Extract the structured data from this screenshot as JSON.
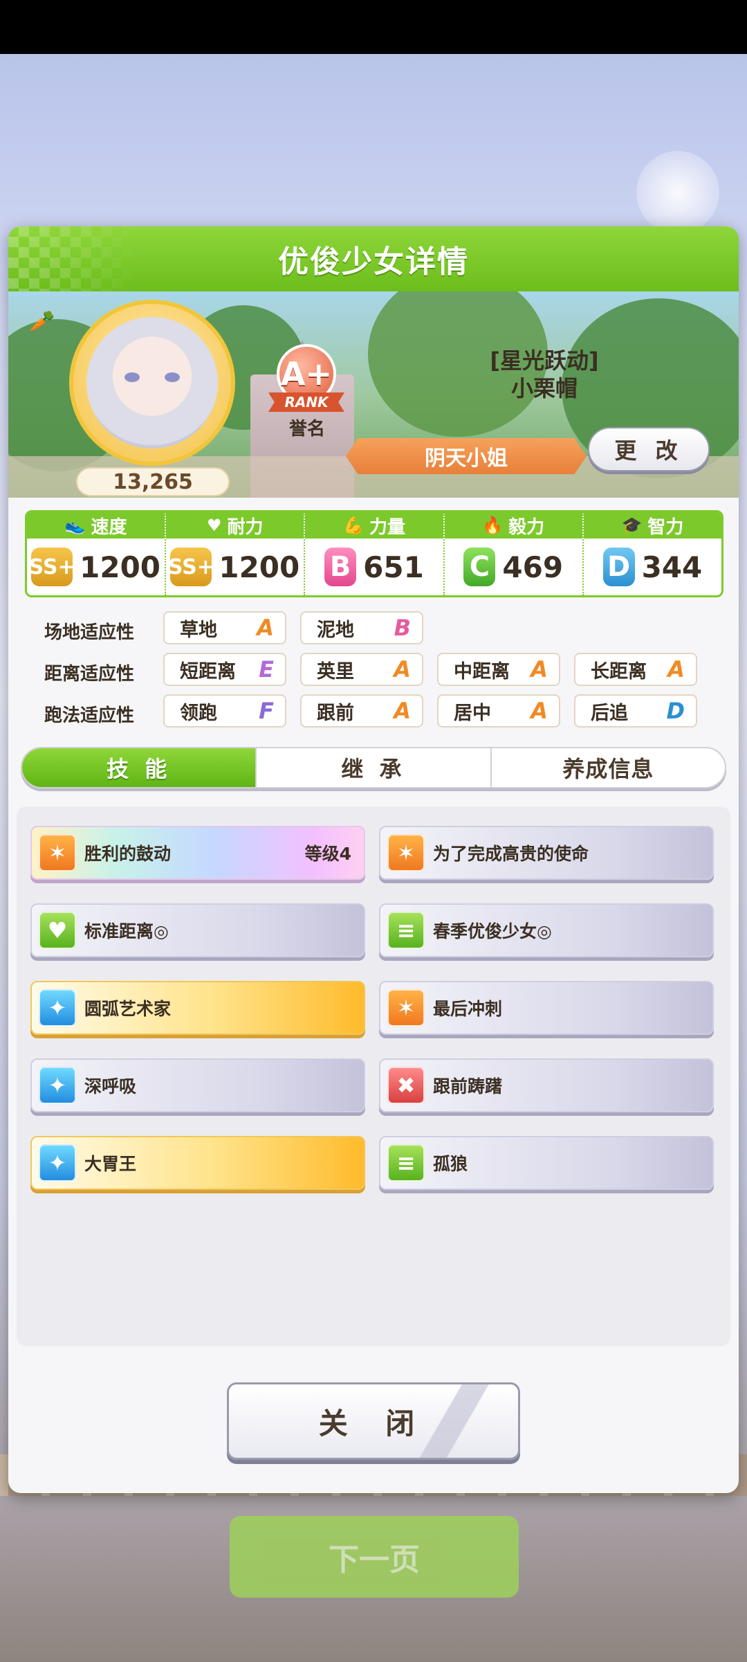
{
  "dialog": {
    "title": "优俊少女详情"
  },
  "profile": {
    "epithet": "[星光跃动]",
    "name": "小栗帽",
    "fans": "13,265",
    "rank_grade": "A+",
    "rank_word": "RANK",
    "rank_label": "誉名",
    "title": "阴天小姐",
    "change_label": "更 改"
  },
  "stats": [
    {
      "label": "速度",
      "icon": "shoe-icon",
      "grade": "SS+",
      "value": "1200"
    },
    {
      "label": "耐力",
      "icon": "heart-icon",
      "grade": "SS+",
      "value": "1200"
    },
    {
      "label": "力量",
      "icon": "muscle-icon",
      "grade": "B",
      "value": "651"
    },
    {
      "label": "毅力",
      "icon": "flame-icon",
      "grade": "C",
      "value": "469"
    },
    {
      "label": "智力",
      "icon": "graduation-cap-icon",
      "grade": "D",
      "value": "344"
    }
  ],
  "aptitude": {
    "track": {
      "label": "场地适应性",
      "items": [
        {
          "name": "草地",
          "grade": "A"
        },
        {
          "name": "泥地",
          "grade": "B"
        }
      ]
    },
    "distance": {
      "label": "距离适应性",
      "items": [
        {
          "name": "短距离",
          "grade": "E"
        },
        {
          "name": "英里",
          "grade": "A"
        },
        {
          "name": "中距离",
          "grade": "A"
        },
        {
          "name": "长距离",
          "grade": "A"
        }
      ]
    },
    "style": {
      "label": "跑法适应性",
      "items": [
        {
          "name": "领跑",
          "grade": "F"
        },
        {
          "name": "跟前",
          "grade": "A"
        },
        {
          "name": "居中",
          "grade": "A"
        },
        {
          "name": "后追",
          "grade": "D"
        }
      ]
    }
  },
  "tabs": [
    "技 能",
    "继 承",
    "养成信息"
  ],
  "skills": [
    {
      "name": "胜利的鼓动",
      "level": "等级4",
      "style": "rainbow",
      "icon": "orange"
    },
    {
      "name": "为了完成高贵的使命",
      "level": "",
      "style": "plain",
      "icon": "orange"
    },
    {
      "name": "标准距离◎",
      "level": "",
      "style": "plain",
      "icon": "green"
    },
    {
      "name": "春季优俊少女◎",
      "level": "",
      "style": "plain",
      "icon": "green"
    },
    {
      "name": "圆弧艺术家",
      "level": "",
      "style": "gold",
      "icon": "blue"
    },
    {
      "name": "最后冲刺",
      "level": "",
      "style": "plain",
      "icon": "orange"
    },
    {
      "name": "深呼吸",
      "level": "",
      "style": "plain",
      "icon": "blue"
    },
    {
      "name": "跟前踌躇",
      "level": "",
      "style": "plain",
      "icon": "red"
    },
    {
      "name": "大胃王",
      "level": "",
      "style": "gold",
      "icon": "blue"
    },
    {
      "name": "孤狼",
      "level": "",
      "style": "plain",
      "icon": "green"
    }
  ],
  "close_label": "关 闭",
  "next_label": "下一页"
}
